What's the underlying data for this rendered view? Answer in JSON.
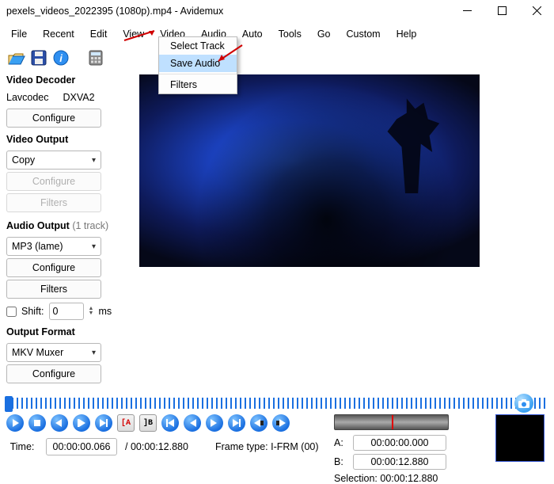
{
  "title": "pexels_videos_2022395 (1080p).mp4 - Avidemux",
  "menubar": {
    "items": [
      "File",
      "Recent",
      "Edit",
      "View",
      "Video",
      "Audio",
      "Auto",
      "Tools",
      "Go",
      "Custom",
      "Help"
    ]
  },
  "dropdown": {
    "items": [
      "Select Track",
      "Save Audio",
      "Filters"
    ],
    "highlight_index": 1
  },
  "left": {
    "decoder_label": "Video Decoder",
    "decoder_name1": "Lavcodec",
    "decoder_name2": "DXVA2",
    "configure": "Configure",
    "filters": "Filters",
    "video_output_label": "Video Output",
    "video_output_value": "Copy",
    "audio_output_label": "Audio Output",
    "audio_output_suffix": "(1 track)",
    "audio_output_value": "MP3 (lame)",
    "shift_label": "Shift:",
    "shift_value": "0",
    "shift_unit": "ms",
    "output_format_label": "Output Format",
    "output_format_value": "MKV Muxer"
  },
  "bottom": {
    "time_label": "Time:",
    "time_value": "00:00:00.066",
    "duration_label": "/ 00:00:12.880",
    "frametype_label": "Frame type: I-FRM (00)",
    "a_label": "A:",
    "a_value": "00:00:00.000",
    "b_label": "B:",
    "b_value": "00:00:12.880",
    "selection_label": "Selection: 00:00:12.880"
  }
}
